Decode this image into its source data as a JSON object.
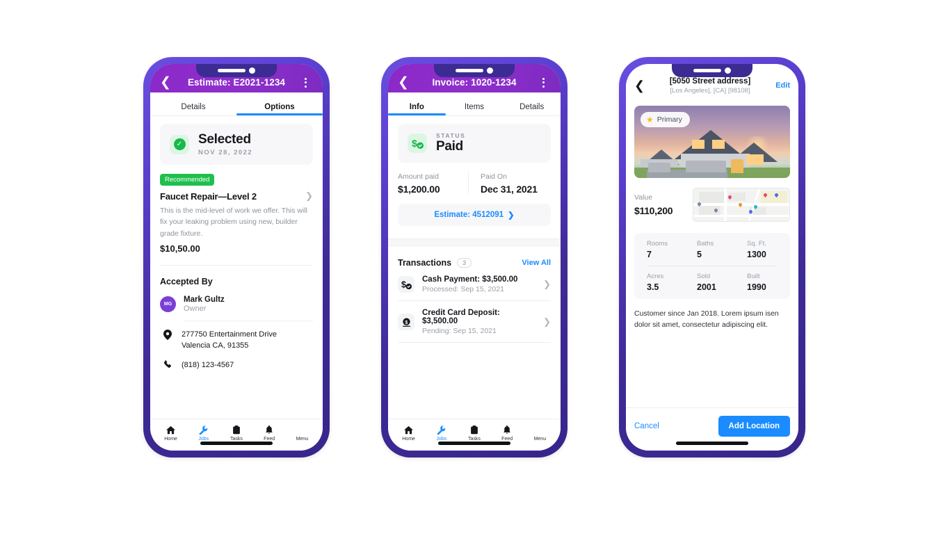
{
  "phones": [
    {
      "id": "estimate",
      "header": {
        "back_icon": "chevron-left-icon",
        "title": "Estimate: E2021-1234",
        "menu_icon": "kebab-menu-icon"
      },
      "tabs": [
        {
          "label": "Details",
          "active": false
        },
        {
          "label": "Options",
          "active": true
        }
      ],
      "status": {
        "icon": "check-circle-icon",
        "title": "Selected",
        "date": "NOV 28, 2022"
      },
      "option": {
        "chip": "Recommended",
        "title": "Faucet Repair—Level 2",
        "chevron_icon": "chevron-right-icon",
        "description": "This is the mid-level of work we offer. This will fix your leaking problem using new, builder grade fixture.",
        "price": "$10,50.00"
      },
      "accepted": {
        "section_title": "Accepted By",
        "avatar_initials": "MG",
        "name": "Mark Gultz",
        "role": "Owner",
        "address_icon": "map-pin-icon",
        "address_line1": "277750 Entertainment Drive",
        "address_line2": "Valencia CA, 91355",
        "phone_icon": "phone-icon",
        "phone": "(818) 123-4567"
      }
    },
    {
      "id": "invoice",
      "header": {
        "back_icon": "chevron-left-icon",
        "title": "Invoice: 1020-1234",
        "menu_icon": "kebab-menu-icon"
      },
      "tabs": [
        {
          "label": "Info",
          "active": true
        },
        {
          "label": "Items",
          "active": false
        },
        {
          "label": "Details",
          "active": false
        }
      ],
      "status": {
        "icon": "dollar-check-icon",
        "label": "STATUS",
        "value": "Paid"
      },
      "amount": {
        "key": "Amount paid",
        "value": "$1,200.00"
      },
      "paid_on": {
        "key": "Paid On",
        "value": "Dec 31, 2021"
      },
      "estimate_button": {
        "label": "Estimate: 4512091",
        "chevron_icon": "chevron-right-icon"
      },
      "transactions": {
        "title": "Transactions",
        "count": "3",
        "view_all": "View All",
        "rows": [
          {
            "icon": "dollar-check-icon",
            "title": "Cash Payment: $3,500.00",
            "subtitle": "Processed: Sep 15, 2021",
            "chevron_icon": "chevron-right-icon"
          },
          {
            "icon": "coin-dollar-icon",
            "title": "Credit Card Deposit: $3,500.00",
            "subtitle": "Pending: Sep 15, 2021",
            "chevron_icon": "chevron-right-icon"
          }
        ]
      }
    },
    {
      "id": "property",
      "header": {
        "back_icon": "chevron-left-icon",
        "title": "[5050 Street address]",
        "subtitle": "[Los Angeles], [CA] [98108]",
        "edit": "Edit"
      },
      "photo": {
        "alt": "house-photo",
        "badge": "Primary",
        "badge_icon": "star-icon"
      },
      "value": {
        "key": "Value",
        "amount": "$110,200",
        "map_alt": "map-thumbnail"
      },
      "facts": [
        {
          "key": "Rooms",
          "value": "7"
        },
        {
          "key": "Baths",
          "value": "5"
        },
        {
          "key": "Sq. Ft.",
          "value": "1300"
        },
        {
          "key": "Acres",
          "value": "3.5"
        },
        {
          "key": "Sold",
          "value": "2001"
        },
        {
          "key": "Built",
          "value": "1990"
        }
      ],
      "note": "Customer since Jan 2018. Lorem ipsum isen dolor sit amet, consectetur adipiscing elit.",
      "actions": {
        "cancel": "Cancel",
        "primary": "Add Location"
      }
    }
  ],
  "bottom_nav": [
    {
      "label": "Home",
      "icon": "home-icon",
      "active": false
    },
    {
      "label": "Jobs",
      "icon": "wrench-icon",
      "active": true
    },
    {
      "label": "Tasks",
      "icon": "clipboard-icon",
      "active": false
    },
    {
      "label": "Feed",
      "icon": "bell-icon",
      "active": false
    },
    {
      "label": "Menu",
      "icon": "menu-icon",
      "active": false
    }
  ],
  "colors": {
    "frame": "#3b2b93",
    "header_purple": "#8f2fcb",
    "accent_blue": "#1a8cff",
    "green": "#1fbf4d",
    "star_yellow": "#f5bb18"
  }
}
